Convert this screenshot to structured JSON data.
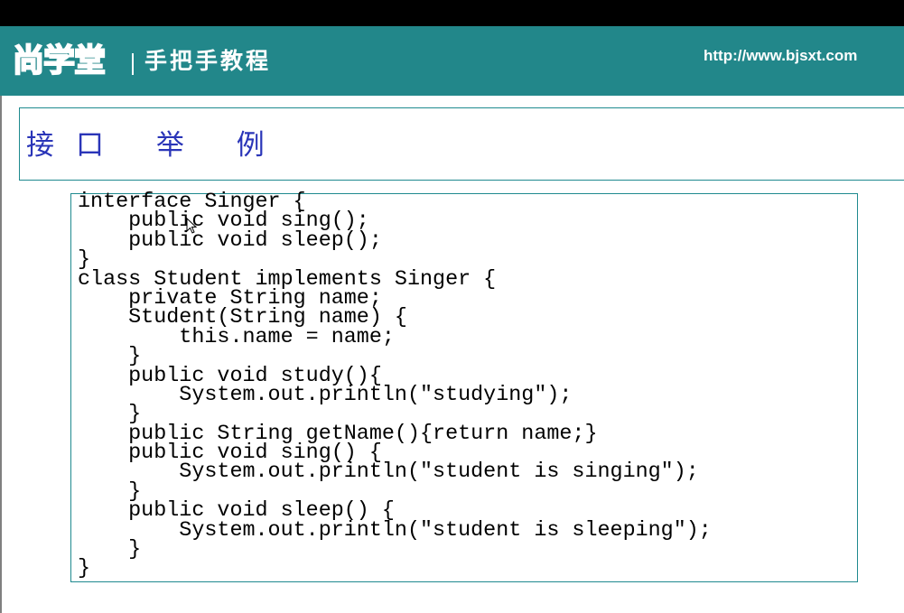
{
  "header": {
    "logo_text": "尚学堂",
    "tagline": "手把手教程",
    "url": "http://www.bjsxt.com"
  },
  "slide": {
    "title": "接口 举 例",
    "code_lines": [
      "interface Singer {",
      "    public void sing();",
      "    public void sleep();",
      "}",
      "class Student implements Singer {",
      "    private String name;",
      "    Student(String name) {",
      "        this.name = name;",
      "    }",
      "    public void study(){",
      "        System.out.println(\"studying\");",
      "    }",
      "    public String getName(){return name;}",
      "    public void sing() {",
      "        System.out.println(\"student is singing\");",
      "    }",
      "    public void sleep() {",
      "        System.out.println(\"student is sleeping\");",
      "    }",
      "}"
    ]
  },
  "icons": {
    "cursor": "mouse-pointer-icon"
  },
  "colors": {
    "header_band": "#22878a",
    "title_text": "#2a35b8",
    "box_border": "#1f8a8f",
    "top_bar": "#000000"
  }
}
